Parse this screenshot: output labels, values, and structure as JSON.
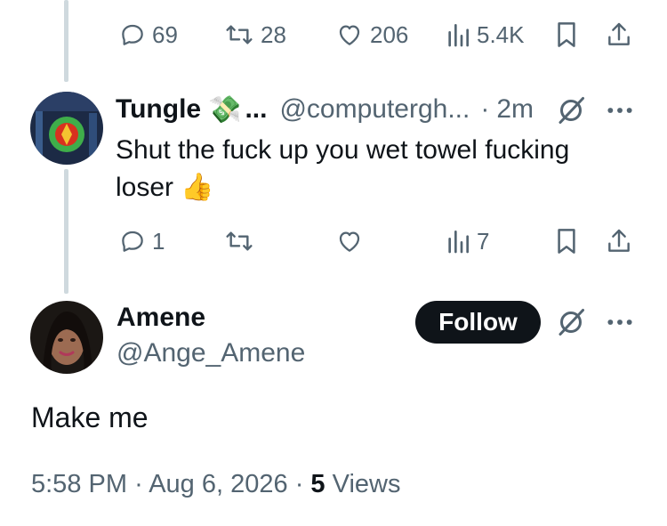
{
  "top_actions": {
    "reply_count": "69",
    "repost_count": "28",
    "like_count": "206",
    "views_count": "5.4K"
  },
  "reply_tweet": {
    "name": "Tungle",
    "name_emoji": "💸",
    "name_ellipsis": "...",
    "handle": "@computergh...",
    "separator": "·",
    "time": "2m",
    "text": "Shut the fuck up you wet towel fucking loser",
    "text_emoji": "👍",
    "actions": {
      "reply_count": "1",
      "views_count": "7"
    }
  },
  "main_tweet": {
    "name": "Amene",
    "handle": "@Ange_Amene",
    "follow_label": "Follow",
    "text": "Make me",
    "time": "5:58 PM",
    "separator1": "·",
    "date": "Aug 6, 2026",
    "separator2": "·",
    "views_count": "5",
    "views_label": "Views"
  },
  "icons": [
    "reply-icon",
    "repost-icon",
    "like-icon",
    "views-icon",
    "bookmark-icon",
    "share-icon",
    "grok-icon",
    "more-icon"
  ],
  "colors": {
    "text": "#0f1419",
    "muted": "#536471",
    "thread_line": "#cfd9de",
    "follow_bg": "#0f1419"
  }
}
